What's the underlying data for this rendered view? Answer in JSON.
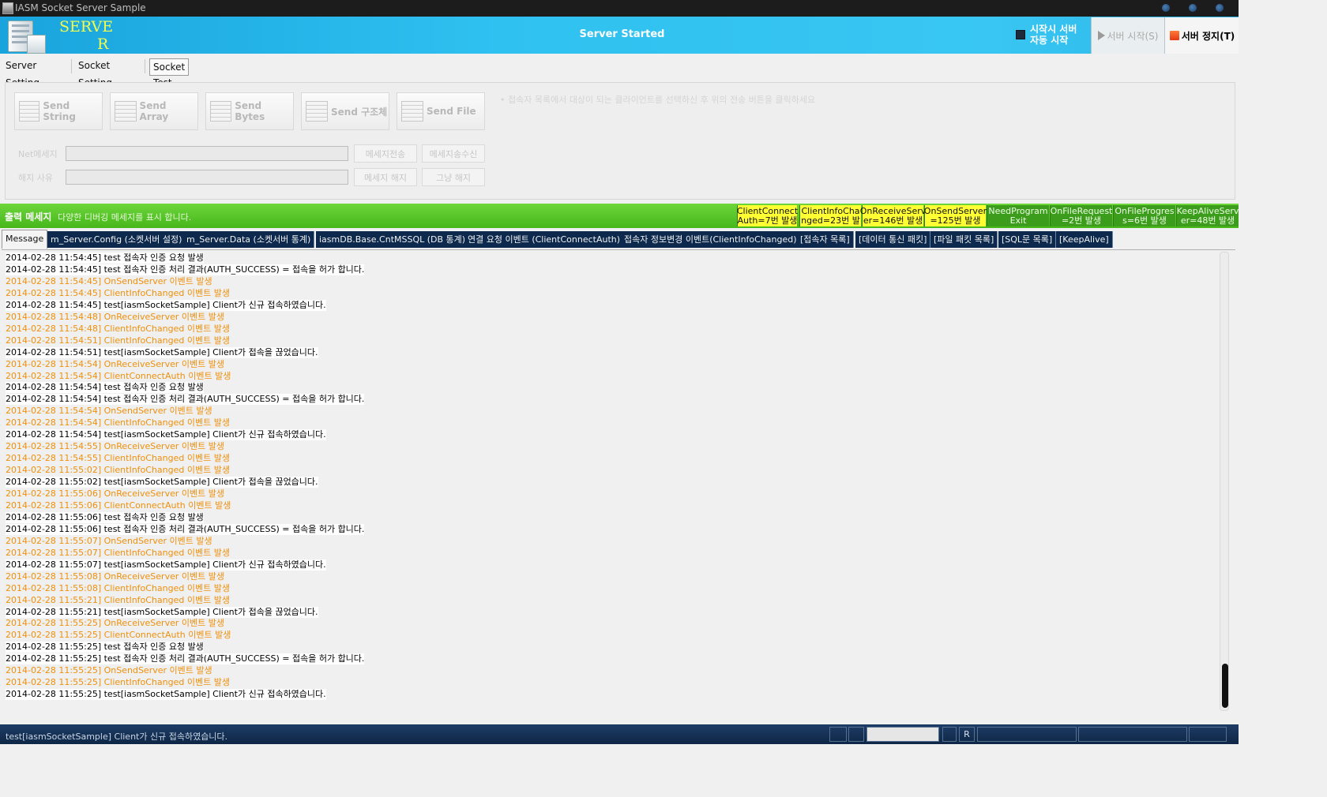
{
  "window": {
    "title": "IASM Socket Server Sample"
  },
  "header": {
    "brand_line1": "SERVE",
    "brand_line2": "R",
    "status": "Server Started",
    "autostart_line1": "시작시 서버",
    "autostart_line2": "자동 시작",
    "start_button": "서버 시작(S)",
    "stop_button": "서버 정지(T)"
  },
  "top_tabs": [
    "Server Setting",
    "Socket Setting",
    "Socket Test"
  ],
  "socket_test": {
    "send_buttons": [
      "Send String",
      "Send Array",
      "Send Bytes",
      "Send 구조체",
      "Send File"
    ],
    "hint": "• 접속자 목록에서 대상이 되는 클라이언트를 선택하신 후 위의 전송 버튼을 클릭하세요",
    "net_label": "Net메세지",
    "reason_label": "해지 사유",
    "btn_send_msg": "메세지전송",
    "btn_send_recv": "메세지송수신",
    "btn_msg_cancel": "메세지 해지",
    "btn_just_cancel": "그냥 해지"
  },
  "output": {
    "title": "출력 메세지",
    "desc": "다양한 디버깅 메세지를 표시 합니다.",
    "events": [
      {
        "l1": "ClientConnect",
        "l2": "Auth=7번 발생",
        "color": "#ffff33"
      },
      {
        "l1": "ClientInfoCha",
        "l2": "nged=23번 발",
        "color": "#ffff33"
      },
      {
        "l1": "OnReceiveServ",
        "l2": "er=146번 발생",
        "color": "#ffff33"
      },
      {
        "l1": "OnSendServer",
        "l2": "=125번 발생",
        "color": "#ffff33"
      },
      {
        "l1": "NeedProgram",
        "l2": "Exit",
        "color": "#3c9c1c"
      },
      {
        "l1": "OnFileRequest",
        "l2": "=2번 발생",
        "color": "#3c9c1c"
      },
      {
        "l1": "OnFileProgres",
        "l2": "s=6번 발생",
        "color": "#3c9c1c"
      },
      {
        "l1": "KeepAliveServ",
        "l2": "er=48번 발생",
        "color": "#3c9c1c"
      }
    ],
    "tabs": [
      "Message",
      "m_Server.Config (소켓서버 설정)",
      "m_Server.Data (소켓서버 통계)",
      "iasmDB.Base.CntMSSQL (DB 통계)",
      "연결 요청 이벤트 (ClientConnectAuth)",
      "접속자 정보변경 이벤트(ClientInfoChanged)",
      "[접속자 목록]",
      "[데이터 통신 패킷]",
      "[파일 패킷 목록]",
      "[SQL문 목록]",
      "[KeepAlive]"
    ]
  },
  "log": [
    {
      "t": "2014-02-28 11:54:45] test 접속자 인증 요청 발생",
      "c": "n"
    },
    {
      "t": "2014-02-28 11:54:45] test 접속자 인증 처리 결과(AUTH_SUCCESS) = 접속을 허가 합니다.",
      "c": "n"
    },
    {
      "t": "2014-02-28 11:54:45] OnSendServer 이벤트 발생",
      "c": "o"
    },
    {
      "t": "2014-02-28 11:54:45] ClientInfoChanged 이벤트 발생",
      "c": "o"
    },
    {
      "t": "2014-02-28 11:54:45] test[iasmSocketSample] Client가 신규 접속하였습니다.",
      "c": "n"
    },
    {
      "t": "2014-02-28 11:54:48] OnReceiveServer 이벤트 발생",
      "c": "o"
    },
    {
      "t": "2014-02-28 11:54:48] ClientInfoChanged 이벤트 발생",
      "c": "o"
    },
    {
      "t": "2014-02-28 11:54:51] ClientInfoChanged 이벤트 발생",
      "c": "o"
    },
    {
      "t": "2014-02-28 11:54:51] test[iasmSocketSample] Client가 접속을 끊었습니다.",
      "c": "n"
    },
    {
      "t": "2014-02-28 11:54:54] OnReceiveServer 이벤트 발생",
      "c": "o"
    },
    {
      "t": "2014-02-28 11:54:54] ClientConnectAuth 이벤트 발생",
      "c": "o"
    },
    {
      "t": "2014-02-28 11:54:54] test 접속자 인증 요청 발생",
      "c": "n"
    },
    {
      "t": "2014-02-28 11:54:54] test 접속자 인증 처리 결과(AUTH_SUCCESS) = 접속을 허가 합니다.",
      "c": "n"
    },
    {
      "t": "2014-02-28 11:54:54] OnSendServer 이벤트 발생",
      "c": "o"
    },
    {
      "t": "2014-02-28 11:54:54] ClientInfoChanged 이벤트 발생",
      "c": "o"
    },
    {
      "t": "2014-02-28 11:54:54] test[iasmSocketSample] Client가 신규 접속하였습니다.",
      "c": "n"
    },
    {
      "t": "2014-02-28 11:54:55] OnReceiveServer 이벤트 발생",
      "c": "o"
    },
    {
      "t": "2014-02-28 11:54:55] ClientInfoChanged 이벤트 발생",
      "c": "o"
    },
    {
      "t": "2014-02-28 11:55:02] ClientInfoChanged 이벤트 발생",
      "c": "o"
    },
    {
      "t": "2014-02-28 11:55:02] test[iasmSocketSample] Client가 접속을 끊었습니다.",
      "c": "n"
    },
    {
      "t": "2014-02-28 11:55:06] OnReceiveServer 이벤트 발생",
      "c": "o"
    },
    {
      "t": "2014-02-28 11:55:06] ClientConnectAuth 이벤트 발생",
      "c": "o"
    },
    {
      "t": "2014-02-28 11:55:06] test 접속자 인증 요청 발생",
      "c": "n"
    },
    {
      "t": "2014-02-28 11:55:06] test 접속자 인증 처리 결과(AUTH_SUCCESS) = 접속을 허가 합니다.",
      "c": "n"
    },
    {
      "t": "2014-02-28 11:55:07] OnSendServer 이벤트 발생",
      "c": "o"
    },
    {
      "t": "2014-02-28 11:55:07] ClientInfoChanged 이벤트 발생",
      "c": "o"
    },
    {
      "t": "2014-02-28 11:55:07] test[iasmSocketSample] Client가 신규 접속하였습니다.",
      "c": "n"
    },
    {
      "t": "2014-02-28 11:55:08] OnReceiveServer 이벤트 발생",
      "c": "o"
    },
    {
      "t": "2014-02-28 11:55:08] ClientInfoChanged 이벤트 발생",
      "c": "o"
    },
    {
      "t": "2014-02-28 11:55:21] ClientInfoChanged 이벤트 발생",
      "c": "o"
    },
    {
      "t": "2014-02-28 11:55:21] test[iasmSocketSample] Client가 접속을 끊었습니다.",
      "c": "n"
    },
    {
      "t": "2014-02-28 11:55:25] OnReceiveServer 이벤트 발생",
      "c": "o"
    },
    {
      "t": "2014-02-28 11:55:25] ClientConnectAuth 이벤트 발생",
      "c": "o"
    },
    {
      "t": "2014-02-28 11:55:25] test 접속자 인증 요청 발생",
      "c": "n"
    },
    {
      "t": "2014-02-28 11:55:25] test 접속자 인증 처리 결과(AUTH_SUCCESS) = 접속을 허가 합니다.",
      "c": "n"
    },
    {
      "t": "2014-02-28 11:55:25] OnSendServer 이벤트 발생",
      "c": "o"
    },
    {
      "t": "2014-02-28 11:55:25] ClientInfoChanged 이벤트 발생",
      "c": "o"
    },
    {
      "t": "2014-02-28 11:55:25] test[iasmSocketSample] Client가 신규 접속하였습니다.",
      "c": "n"
    }
  ],
  "statusbar": {
    "text": "test[iasmSocketSample] Client가 신규 접속하였습니다.",
    "r_label": "R"
  }
}
